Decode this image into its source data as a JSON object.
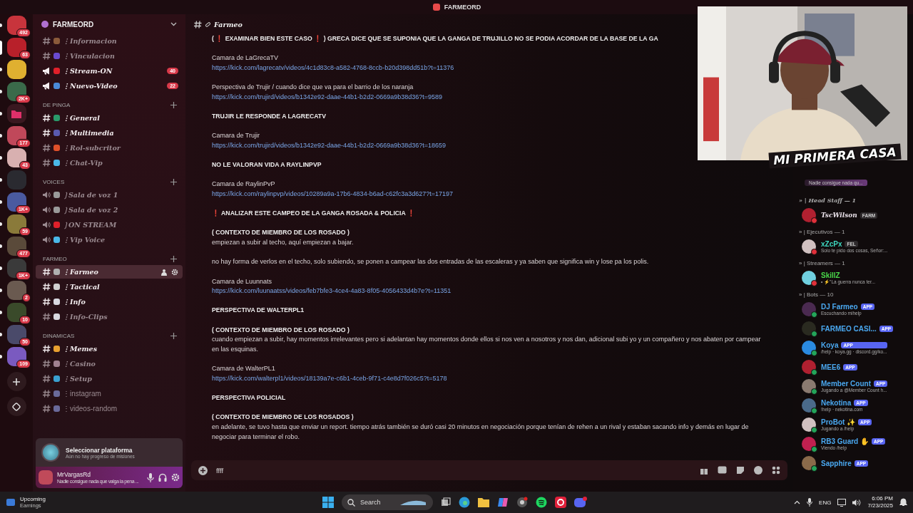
{
  "window": {
    "title": "FARMEORD"
  },
  "servers": [
    {
      "kind": "server",
      "badge": "492",
      "selected": false
    },
    {
      "kind": "server",
      "badge": "63",
      "selected": true
    },
    {
      "kind": "server",
      "selected": false
    },
    {
      "kind": "server",
      "badge": "2K+",
      "selected": false
    },
    {
      "kind": "folder",
      "selected": false
    },
    {
      "kind": "server",
      "badge": "177",
      "selected": false
    },
    {
      "kind": "server",
      "badge": "43",
      "selected": false
    },
    {
      "kind": "server",
      "selected": false
    },
    {
      "kind": "server",
      "badge": "1K+",
      "selected": false
    },
    {
      "kind": "server",
      "badge": "59",
      "selected": false
    },
    {
      "kind": "server",
      "badge": "477",
      "selected": false
    },
    {
      "kind": "server",
      "badge": "1K+",
      "selected": false
    },
    {
      "kind": "server",
      "badge": "2",
      "selected": false
    },
    {
      "kind": "server",
      "badge": "10",
      "selected": false
    },
    {
      "kind": "server",
      "badge": "50",
      "selected": false
    },
    {
      "kind": "server",
      "badge": "109",
      "selected": false
    }
  ],
  "sidebar": {
    "header": "FARMEORD",
    "groups": [
      {
        "channels": [
          {
            "name": "⋮Informacion",
            "kind": "text",
            "fancy": true,
            "unread": false,
            "selected": false,
            "color": "#8a5a3a"
          },
          {
            "name": "⋮Vinculacion",
            "kind": "text",
            "fancy": true,
            "unread": false,
            "selected": false,
            "color": "#6a4ad0"
          },
          {
            "name": "⋮Stream-ON",
            "kind": "announcement",
            "fancy": true,
            "unread": true,
            "selected": false,
            "color": "#e0202a",
            "badge": "40"
          },
          {
            "name": "⋮Nuevo-Video",
            "kind": "announcement",
            "fancy": true,
            "unread": true,
            "selected": false,
            "color": "#4a8ad8",
            "badge": "22"
          }
        ]
      },
      {
        "category": "DE PINGA",
        "channels": [
          {
            "name": "⋮General",
            "kind": "text",
            "fancy": true,
            "unread": true,
            "selected": false,
            "color": "#2a9a6a"
          },
          {
            "name": "⋮Multimedia",
            "kind": "text",
            "fancy": true,
            "unread": true,
            "selected": false,
            "color": "#5a5ab0"
          },
          {
            "name": "⋮Rol-subcritor",
            "kind": "text",
            "fancy": true,
            "unread": false,
            "selected": false,
            "color": "#e0502a"
          },
          {
            "name": "⋮Chat-Vip",
            "kind": "text",
            "fancy": true,
            "unread": false,
            "selected": false,
            "color": "#4ab8e8"
          }
        ]
      },
      {
        "category": "VOICES",
        "channels": [
          {
            "name": "❳Sala de voz 1",
            "kind": "voice",
            "fancy": true,
            "unread": false,
            "selected": false,
            "color": "#9a9a9a"
          },
          {
            "name": "❳Sala de voz 2",
            "kind": "voice",
            "fancy": true,
            "unread": false,
            "selected": false,
            "color": "#9a9a9a"
          },
          {
            "name": "❳ON STREAM",
            "kind": "voice",
            "fancy": true,
            "unread": false,
            "selected": false,
            "color": "#e0202a"
          },
          {
            "name": "⋮Vip Voice",
            "kind": "voice",
            "fancy": true,
            "unread": false,
            "selected": false,
            "color": "#4ab8e8"
          }
        ]
      },
      {
        "category": "FARMEO",
        "channels": [
          {
            "name": "⋮Farmeo",
            "kind": "text",
            "fancy": true,
            "unread": false,
            "selected": true,
            "color": "#b0b0b0"
          },
          {
            "name": "⋮Tactical",
            "kind": "text",
            "fancy": true,
            "unread": true,
            "selected": false,
            "color": "#d0d0d0"
          },
          {
            "name": "⋮Info",
            "kind": "text",
            "fancy": true,
            "unread": true,
            "selected": false,
            "color": "#d8d8e0"
          },
          {
            "name": "⋮Info-Clips",
            "kind": "text",
            "fancy": true,
            "unread": false,
            "selected": false,
            "color": "#d8d8e0"
          }
        ]
      },
      {
        "category": "DINAMICAS",
        "channels": [
          {
            "name": "⋮Memes",
            "kind": "text",
            "fancy": true,
            "unread": true,
            "selected": false,
            "color": "#e8a030"
          },
          {
            "name": "⋮Casino",
            "kind": "text",
            "fancy": true,
            "unread": false,
            "selected": false,
            "color": "#a08090"
          },
          {
            "name": "⋮Setup",
            "kind": "text",
            "fancy": true,
            "unread": false,
            "selected": false,
            "color": "#3aa0d0"
          },
          {
            "name": "⋮instagram",
            "kind": "text",
            "fancy": false,
            "unread": false,
            "selected": false,
            "color": "#6a6a9a"
          },
          {
            "name": "⋮videos-random",
            "kind": "text",
            "fancy": false,
            "unread": false,
            "selected": false,
            "color": "#6a6a9a"
          }
        ]
      }
    ]
  },
  "quest": {
    "title": "Seleccionar plataforma",
    "subtitle": "Aún no hay progreso de misiones"
  },
  "user": {
    "name": "MrVargasRd",
    "status": "Nadie consigue nada que valga la pena ..."
  },
  "channel": {
    "name": "Farmeo"
  },
  "messages": [
    {
      "lines": [
        {
          "kind": "heading",
          "text": "( ❗ EXAMINAR BIEN ESTE CASO ❗ ) GRECA DICE QUE SE SUPONIA QUE LA GANGA DE TRUJILLO NO SE PODIA ACORDAR DE LA BASE DE LA GA"
        }
      ]
    },
    {
      "lines": [
        {
          "kind": "text",
          "text": "Camara de LaGrecaTV"
        },
        {
          "kind": "link",
          "text": "https://kick.com/lagrecatv/videos/4c1d83c8-a582-4768-8ccb-b20d398dd51b?t=11376"
        }
      ]
    },
    {
      "lines": [
        {
          "kind": "text",
          "text": "Perspectiva de Trujir / cuando dice que va para el barrio de los naranja"
        },
        {
          "kind": "link",
          "text": "https://kick.com/trujird/videos/b1342e92-daae-44b1-b2d2-0669a9b38d36?t=9589"
        }
      ]
    },
    {
      "lines": [
        {
          "kind": "heading",
          "text": "TRUJIR LE RESPONDE A LAGRECATV"
        }
      ]
    },
    {
      "lines": [
        {
          "kind": "text",
          "text": "Camara de Trujir"
        },
        {
          "kind": "link",
          "text": "https://kick.com/trujird/videos/b1342e92-daae-44b1-b2d2-0669a9b38d36?t=18659"
        }
      ]
    },
    {
      "lines": [
        {
          "kind": "heading",
          "text": "NO LE VALORAN VIDA A RAYLINPVP"
        }
      ]
    },
    {
      "lines": [
        {
          "kind": "text",
          "text": "Camara de RaylinPvP"
        },
        {
          "kind": "link",
          "text": "https://kick.com/raylinpvp/videos/10289a9a-17b6-4834-b6ad-c62fc3a3d627?t=17197"
        }
      ]
    },
    {
      "lines": [
        {
          "kind": "heading",
          "text": "❗ ANALIZAR ESTE CAMPEO DE LA GANGA ROSADA & POLICIA ❗"
        }
      ]
    },
    {
      "lines": [
        {
          "kind": "heading",
          "text": "( CONTEXTO DE MIEMBRO DE LOS ROSADO )"
        },
        {
          "kind": "text",
          "text": " empiezan a subir al techo, aquí empiezan a bajar."
        }
      ]
    },
    {
      "lines": [
        {
          "kind": "text",
          "text": "no hay forma de verlos en el techo, solo subiendo, se ponen a campear las dos entradas de las escaleras y ya saben que significa win y lose pa los polis."
        }
      ]
    },
    {
      "lines": [
        {
          "kind": "text",
          "text": "Camara de Luunnats"
        },
        {
          "kind": "link",
          "text": "https://kick.com/luunaatss/videos/feb7bfe3-4ce4-4a83-8f05-4056433d4b7e?t=11351"
        }
      ]
    },
    {
      "lines": [
        {
          "kind": "heading",
          "text": "PERSPECTIVA DE WALTERPL1"
        }
      ]
    },
    {
      "lines": [
        {
          "kind": "heading",
          "text": "( CONTEXTO DE MIEMBRO DE LOS ROSADO )"
        },
        {
          "kind": "text",
          "text": "cuando empiezan a subir, hay momentos irrelevantes pero si adelantan hay momentos donde ellos si nos ven a nosotros y nos dan, adicional subi yo y un compañero y nos abaten por campear en las esquinas."
        }
      ]
    },
    {
      "lines": [
        {
          "kind": "text",
          "text": "Camara de WalterPL1"
        },
        {
          "kind": "link",
          "text": "https://kick.com/walterpl1/videos/18139a7e-c6b1-4ceb-9f71-c4e8d7f026c5?t=5178"
        }
      ]
    },
    {
      "lines": [
        {
          "kind": "heading",
          "text": " PERSPECTIVA POLICIAL"
        }
      ]
    },
    {
      "lines": [
        {
          "kind": "heading",
          "text": "( CONTEXTO DE MIEMBRO DE LOS ROSADOS )"
        },
        {
          "kind": "text",
          "text": "en adelante, se tuvo hasta que enviar un report. tiempo atrás también se duró casi 20 minutos en negociación porque tenían de rehen a un rival y estaban sacando info y demás en lugar de negociar para terminar el robo."
        }
      ]
    }
  ],
  "composer": {
    "value": "ffff"
  },
  "overlay": {
    "title": "MI PRIMERA CASA",
    "status": "Nadie consigue nada qu..."
  },
  "member_groups": [
    {
      "title": "» | Head Staff — 1",
      "fancy": true,
      "members": [
        {
          "name": "TscWilson",
          "fancy": true,
          "color": "#e8e0e8",
          "tag": "FARM",
          "app": false,
          "dnd": true
        }
      ]
    },
    {
      "title": "» | Ejecutivos — 1",
      "fancy": false,
      "members": [
        {
          "name": "xZcPx",
          "fancy": false,
          "color": "#3ed8c0",
          "tag": "FEL",
          "app": false,
          "subtitle": "Solo te pido dos cosas, Señor:...",
          "dnd": true
        }
      ]
    },
    {
      "title": "» |  Streamers — 1",
      "fancy": false,
      "members": [
        {
          "name": "SkillZ",
          "fancy": false,
          "color": "#4ad84a",
          "subtitle": "• ⚡\"La guerra nunca ter...",
          "dnd": true
        }
      ]
    },
    {
      "title": "» | Bots — 10",
      "fancy": false,
      "members": [
        {
          "name": "DJ Farmeo",
          "fancy": false,
          "color": "#4aa8f0",
          "tag": "APP",
          "app": true,
          "subtitle": "Escuchando mihelp",
          "dnd": false
        },
        {
          "name": "FARMEO CASI...",
          "fancy": false,
          "color": "#4aa8f0",
          "tag": "APP",
          "app": true,
          "dnd": false
        },
        {
          "name": "Koya",
          "fancy": false,
          "color": "#4aa8f0",
          "tag": "APP",
          "app": true,
          "subtitle": "/help · koya.gg · discord.gg/ko...",
          "dnd": false
        },
        {
          "name": "MEE6",
          "fancy": false,
          "color": "#4aa8f0",
          "tag": "APP",
          "app": true,
          "dnd": false
        },
        {
          "name": "Member Count",
          "fancy": false,
          "color": "#4aa8f0",
          "tag": "APP",
          "app": true,
          "subtitle": "Jugando a @Member Count h...",
          "dnd": false
        },
        {
          "name": "Nekotina",
          "fancy": false,
          "color": "#4aa8f0",
          "tag": "APP",
          "app": true,
          "subtitle": "!help · nekotina.com",
          "dnd": false
        },
        {
          "name": "ProBot ✨",
          "fancy": false,
          "color": "#4aa8f0",
          "tag": "APP",
          "app": true,
          "subtitle": "Jugando a /help",
          "dnd": false
        },
        {
          "name": "RB3 Guard ✋",
          "fancy": false,
          "color": "#4aa8f0",
          "tag": "APP",
          "app": true,
          "subtitle": "Viendo /help",
          "dnd": false
        },
        {
          "name": "Sapphire",
          "fancy": false,
          "color": "#4aa8f0",
          "tag": "APP",
          "app": true,
          "dnd": false
        }
      ]
    }
  ],
  "taskbar": {
    "widget_title": "Upcoming",
    "widget_subtitle": "Earnings",
    "search_label": "Search",
    "language": "ENG",
    "time": "6:06 PM",
    "date": "7/23/2025"
  }
}
